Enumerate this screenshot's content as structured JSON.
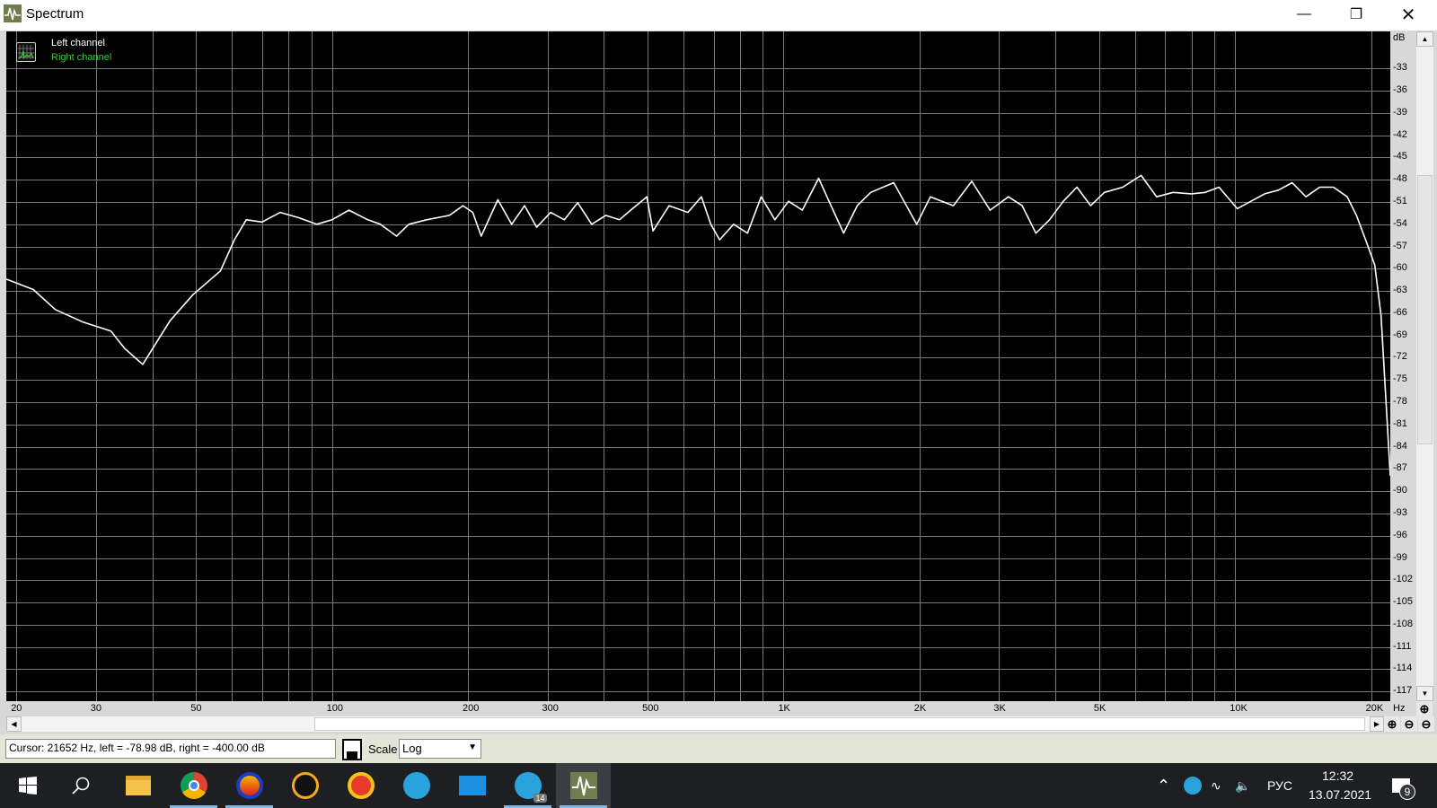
{
  "window": {
    "title": "Spectrum",
    "icon": "spectrum-app-icon",
    "controls": [
      "minimize-icon",
      "restore-icon",
      "close-icon"
    ]
  },
  "legend": {
    "left": "Left channel",
    "right": "Right channel",
    "left_color": "#ffffff",
    "right_color": "#3ec23e"
  },
  "chart_data": {
    "type": "line",
    "x_scale": "log",
    "xlim": [
      19,
      22060
    ],
    "ylim": [
      -118.3,
      -28
    ],
    "grid": true,
    "legend_placement": "top-left",
    "x_unit_label": "Hz",
    "y_unit_label": "dB",
    "x_ticks": [
      {
        "v": 20,
        "label": "20"
      },
      {
        "v": 30,
        "label": "30"
      },
      {
        "v": 50,
        "label": "50"
      },
      {
        "v": 100,
        "label": "100"
      },
      {
        "v": 200,
        "label": "200"
      },
      {
        "v": 300,
        "label": "300"
      },
      {
        "v": 500,
        "label": "500"
      },
      {
        "v": 1000,
        "label": "1K"
      },
      {
        "v": 2000,
        "label": "2K"
      },
      {
        "v": 3000,
        "label": "3K"
      },
      {
        "v": 5000,
        "label": "5K"
      },
      {
        "v": 10000,
        "label": "10K"
      },
      {
        "v": 20000,
        "label": "20K"
      }
    ],
    "y_ticks": [
      -33,
      -36,
      -39,
      -42,
      -45,
      -48,
      -51,
      -54,
      -57,
      -60,
      -63,
      -66,
      -69,
      -72,
      -75,
      -78,
      -81,
      -84,
      -87,
      -90,
      -93,
      -96,
      -99,
      -102,
      -105,
      -108,
      -111,
      -114,
      -117
    ],
    "series": [
      {
        "name": "Left channel",
        "color": "#ffffff",
        "x": [
          19,
          21.8,
          24.4,
          28.1,
          32.4,
          34.7,
          38.1,
          43.8,
          49.2,
          56.6,
          60.8,
          64.6,
          70,
          76.8,
          84.3,
          92.5,
          100,
          109,
          120,
          128,
          139,
          148,
          162,
          182,
          195,
          205,
          214,
          233,
          250,
          267,
          284,
          305,
          327,
          350,
          376,
          404,
          433,
          463,
          498,
          514,
          558,
          614,
          658,
          690,
          722,
          775,
          832,
          892,
          957,
          1026,
          1100,
          1196,
          1265,
          1358,
          1456,
          1560,
          1754,
          1972,
          2114,
          2377,
          2611,
          2866,
          3148,
          3376,
          3620,
          3882,
          4163,
          4464,
          4787,
          5134,
          5637,
          6192,
          6700,
          7290,
          8000,
          8590,
          9210,
          10110,
          10840,
          11630,
          12470,
          13370,
          14350,
          15390,
          16510,
          17710,
          18560,
          19450,
          20380,
          21040,
          21530,
          22060
        ],
        "y": [
          -61.4,
          -62.8,
          -65.5,
          -67.2,
          -68.4,
          -70.7,
          -72.9,
          -67.0,
          -63.5,
          -60.3,
          -56.1,
          -53.4,
          -53.7,
          -52.4,
          -53.1,
          -54.0,
          -53.4,
          -52.1,
          -53.4,
          -54.0,
          -55.6,
          -54.0,
          -53.4,
          -52.8,
          -51.5,
          -52.4,
          -55.6,
          -50.7,
          -54.0,
          -51.5,
          -54.4,
          -52.4,
          -53.4,
          -51.1,
          -54.0,
          -52.8,
          -53.4,
          -51.9,
          -50.3,
          -54.9,
          -51.5,
          -52.4,
          -50.3,
          -54.0,
          -56.1,
          -54.0,
          -55.2,
          -50.3,
          -53.4,
          -50.9,
          -52.1,
          -47.8,
          -51.1,
          -55.2,
          -51.5,
          -49.7,
          -48.4,
          -54.0,
          -50.3,
          -51.5,
          -48.2,
          -52.1,
          -50.3,
          -51.5,
          -55.2,
          -53.4,
          -50.9,
          -49.0,
          -51.5,
          -49.7,
          -49.0,
          -47.4,
          -50.3,
          -49.7,
          -49.9,
          -49.7,
          -49.0,
          -51.9,
          -50.9,
          -49.9,
          -49.4,
          -48.4,
          -50.3,
          -49.0,
          -49.0,
          -50.3,
          -52.8,
          -56.1,
          -59.5,
          -66.3,
          -76.8,
          -87.9
        ]
      }
    ]
  },
  "xaxis_hz": "Hz",
  "yaxis_db": "dB",
  "status": {
    "cursor_text": "Cursor:  21652 Hz,  left = -78.98 dB,  right = -400.00 dB",
    "scale_label": "Scale",
    "scale_value": "Log"
  },
  "taskbar": {
    "apps": [
      "windows-start-icon",
      "search-icon",
      "file-explorer-icon",
      "chrome-icon",
      "audacity-icon",
      "aimp-icon",
      "music-player-icon",
      "telegram-icon",
      "mail-icon",
      "telegram-2-icon",
      "spectrum-icon"
    ],
    "telegram_badge": "14",
    "tray": {
      "language": "РУС",
      "time": "12:32",
      "date": "13.07.2021",
      "notifications": "9"
    }
  }
}
